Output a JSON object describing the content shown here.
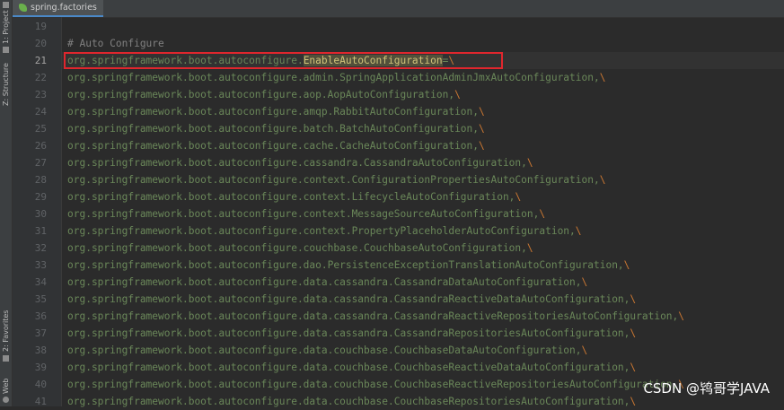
{
  "window": {
    "tab_label": "spring.factories",
    "tool_windows": {
      "project": "1: Project",
      "structure": "Z: Structure",
      "favorites": "2: Favorites",
      "web": "Web"
    }
  },
  "editor": {
    "current_line_number": 21,
    "highlighted_key": "EnableAutoConfiguration",
    "lines": [
      {
        "n": "19",
        "prefix": "",
        "key": "",
        "suffix": "",
        "esc": ""
      },
      {
        "n": "20",
        "prefix": "# Auto Configure",
        "key": "",
        "suffix": "",
        "esc": ""
      },
      {
        "n": "21",
        "prefix": "org.springframework.boot.autoconfigure.",
        "key": "EnableAutoConfiguration",
        "suffix": "=",
        "esc": "\\"
      },
      {
        "n": "22",
        "prefix": "org.springframework.boot.autoconfigure.admin.SpringApplicationAdminJmxAutoConfiguration,",
        "key": "",
        "suffix": "",
        "esc": "\\"
      },
      {
        "n": "23",
        "prefix": "org.springframework.boot.autoconfigure.aop.AopAutoConfiguration,",
        "key": "",
        "suffix": "",
        "esc": "\\"
      },
      {
        "n": "24",
        "prefix": "org.springframework.boot.autoconfigure.amqp.RabbitAutoConfiguration,",
        "key": "",
        "suffix": "",
        "esc": "\\"
      },
      {
        "n": "25",
        "prefix": "org.springframework.boot.autoconfigure.batch.BatchAutoConfiguration,",
        "key": "",
        "suffix": "",
        "esc": "\\"
      },
      {
        "n": "26",
        "prefix": "org.springframework.boot.autoconfigure.cache.CacheAutoConfiguration,",
        "key": "",
        "suffix": "",
        "esc": "\\"
      },
      {
        "n": "27",
        "prefix": "org.springframework.boot.autoconfigure.cassandra.CassandraAutoConfiguration,",
        "key": "",
        "suffix": "",
        "esc": "\\"
      },
      {
        "n": "28",
        "prefix": "org.springframework.boot.autoconfigure.context.ConfigurationPropertiesAutoConfiguration,",
        "key": "",
        "suffix": "",
        "esc": "\\"
      },
      {
        "n": "29",
        "prefix": "org.springframework.boot.autoconfigure.context.LifecycleAutoConfiguration,",
        "key": "",
        "suffix": "",
        "esc": "\\"
      },
      {
        "n": "30",
        "prefix": "org.springframework.boot.autoconfigure.context.MessageSourceAutoConfiguration,",
        "key": "",
        "suffix": "",
        "esc": "\\"
      },
      {
        "n": "31",
        "prefix": "org.springframework.boot.autoconfigure.context.PropertyPlaceholderAutoConfiguration,",
        "key": "",
        "suffix": "",
        "esc": "\\"
      },
      {
        "n": "32",
        "prefix": "org.springframework.boot.autoconfigure.couchbase.CouchbaseAutoConfiguration,",
        "key": "",
        "suffix": "",
        "esc": "\\"
      },
      {
        "n": "33",
        "prefix": "org.springframework.boot.autoconfigure.dao.PersistenceExceptionTranslationAutoConfiguration,",
        "key": "",
        "suffix": "",
        "esc": "\\"
      },
      {
        "n": "34",
        "prefix": "org.springframework.boot.autoconfigure.data.cassandra.CassandraDataAutoConfiguration,",
        "key": "",
        "suffix": "",
        "esc": "\\"
      },
      {
        "n": "35",
        "prefix": "org.springframework.boot.autoconfigure.data.cassandra.CassandraReactiveDataAutoConfiguration,",
        "key": "",
        "suffix": "",
        "esc": "\\"
      },
      {
        "n": "36",
        "prefix": "org.springframework.boot.autoconfigure.data.cassandra.CassandraReactiveRepositoriesAutoConfiguration,",
        "key": "",
        "suffix": "",
        "esc": "\\"
      },
      {
        "n": "37",
        "prefix": "org.springframework.boot.autoconfigure.data.cassandra.CassandraRepositoriesAutoConfiguration,",
        "key": "",
        "suffix": "",
        "esc": "\\"
      },
      {
        "n": "38",
        "prefix": "org.springframework.boot.autoconfigure.data.couchbase.CouchbaseDataAutoConfiguration,",
        "key": "",
        "suffix": "",
        "esc": "\\"
      },
      {
        "n": "39",
        "prefix": "org.springframework.boot.autoconfigure.data.couchbase.CouchbaseReactiveDataAutoConfiguration,",
        "key": "",
        "suffix": "",
        "esc": "\\"
      },
      {
        "n": "40",
        "prefix": "org.springframework.boot.autoconfigure.data.couchbase.CouchbaseReactiveRepositoriesAutoConfiguration,",
        "key": "",
        "suffix": "",
        "esc": "\\"
      },
      {
        "n": "41",
        "prefix": "org.springframework.boot.autoconfigure.data.couchbase.CouchbaseRepositoriesAutoConfiguration,",
        "key": "",
        "suffix": "",
        "esc": "\\"
      }
    ]
  },
  "watermark": "CSDN @鸨哥学JAVA",
  "colors": {
    "background": "#2b2b2b",
    "string_green": "#6a8759",
    "comment_gray": "#808080",
    "highlight_box_red": "#e0262d",
    "escape_orange": "#cc7832"
  }
}
